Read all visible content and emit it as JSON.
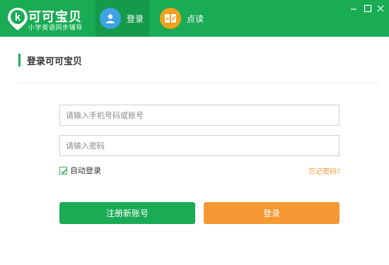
{
  "app": {
    "title": "可可宝贝",
    "subtitle": "小学英语同步辅导",
    "logo_letter": "k"
  },
  "tabs": [
    {
      "label": "登录",
      "icon": "user-icon",
      "active": true
    },
    {
      "label": "点读",
      "icon": "read-icon",
      "active": false
    }
  ],
  "window_controls": [
    "minimize-icon",
    "maximize-icon",
    "close-icon"
  ],
  "page": {
    "heading": "登录可可宝贝"
  },
  "form": {
    "account_placeholder": "请输入手机号码或账号",
    "account_value": "",
    "password_placeholder": "请输入密码",
    "password_value": "",
    "auto_login_label": "自动登录",
    "auto_login_checked": true,
    "forgot_label": "忘记密码?",
    "register_label": "注册新账号",
    "login_label": "登录"
  },
  "colors": {
    "brand_green": "#1aab55",
    "accent_orange": "#f69833",
    "link_orange": "#f39a36",
    "tab_blue": "#3ea2e3"
  }
}
